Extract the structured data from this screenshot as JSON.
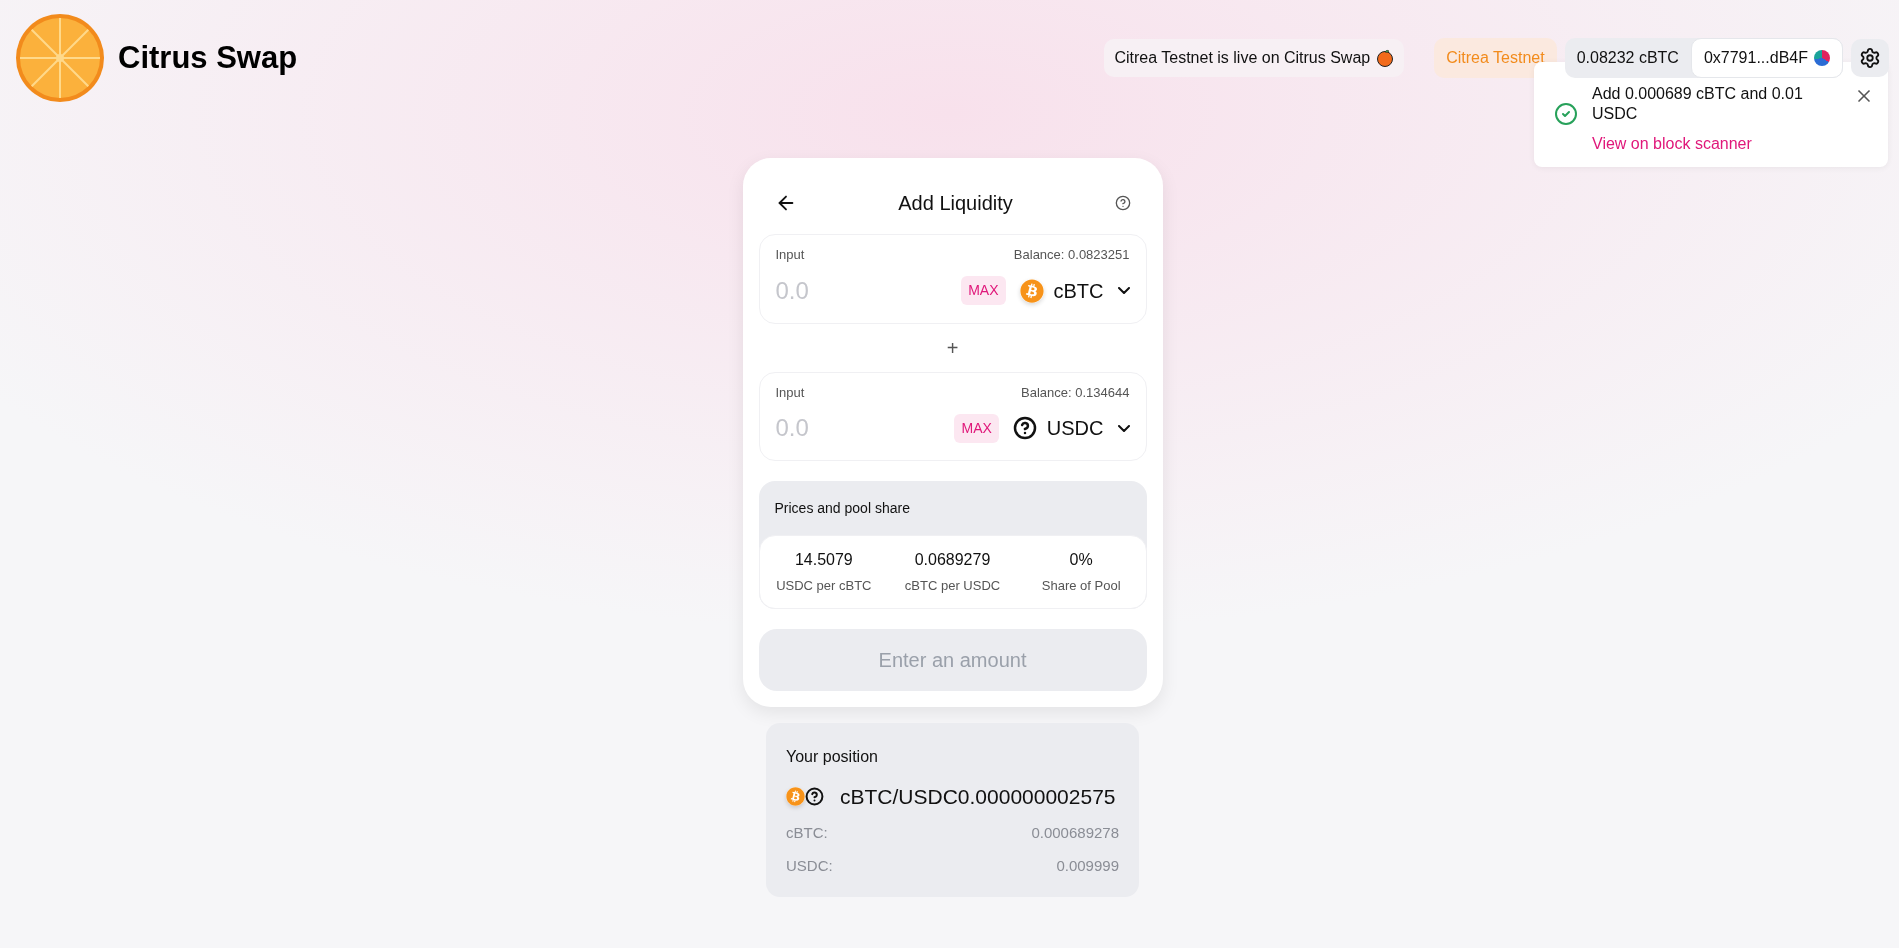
{
  "header": {
    "logo_text": "Citrus Swap",
    "announcement": "Citrea Testnet is live on Citrus Swap",
    "network": "Citrea Testnet",
    "balance": "0.08232 cBTC",
    "address": "0x7791...dB4F"
  },
  "toast": {
    "message": "Add 0.000689 cBTC and 0.01 USDC",
    "link": "View on block scanner"
  },
  "card": {
    "title": "Add Liquidity",
    "plus": "+",
    "inputs": [
      {
        "label": "Input",
        "balance": "Balance: 0.0823251",
        "placeholder": "0.0",
        "max": "MAX",
        "token": {
          "symbol": "cBTC",
          "kind": "bitcoin"
        }
      },
      {
        "label": "Input",
        "balance": "Balance: 0.134644",
        "placeholder": "0.0",
        "max": "MAX",
        "token": {
          "symbol": "USDC",
          "kind": "unknown"
        }
      }
    ],
    "prices": {
      "title": "Prices and pool share",
      "items": [
        {
          "value": "14.5079",
          "label": "USDC per cBTC"
        },
        {
          "value": "0.0689279",
          "label": "cBTC per USDC"
        },
        {
          "value": "0%",
          "label": "Share of Pool"
        }
      ]
    },
    "submit": {
      "label": "Enter an amount",
      "disabled": true
    }
  },
  "position": {
    "title": "Your position",
    "pair": "cBTC/USDC0.000000002575",
    "tokens": [
      {
        "kind": "bitcoin"
      },
      {
        "kind": "unknown"
      }
    ],
    "rows": [
      {
        "label": "cBTC:",
        "value": "0.000689278"
      },
      {
        "label": "USDC:",
        "value": "0.009999"
      }
    ]
  }
}
